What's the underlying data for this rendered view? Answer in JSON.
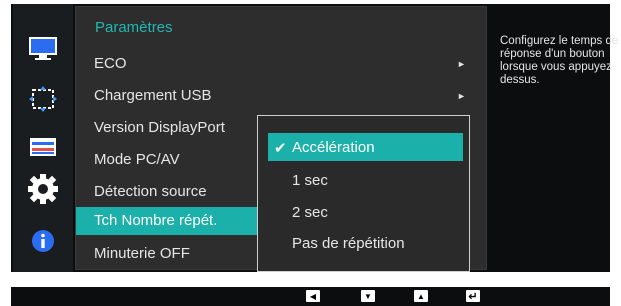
{
  "menu": {
    "title": "Paramètres",
    "items": [
      {
        "label": "ECO",
        "arrow": "►"
      },
      {
        "label": "Chargement USB",
        "arrow": "►"
      },
      {
        "label": "Version DisplayPort",
        "arrow": ""
      },
      {
        "label": "Mode PC/AV",
        "arrow": ""
      },
      {
        "label": "Détection source",
        "arrow": ""
      },
      {
        "label": "Tch Nombre répét.",
        "arrow": ""
      },
      {
        "label": "Minuterie OFF",
        "arrow": ""
      }
    ],
    "selected_index": 5
  },
  "submenu": {
    "check": "✔",
    "options": [
      {
        "label": "Accélération"
      },
      {
        "label": "1 sec"
      },
      {
        "label": "2 sec"
      },
      {
        "label": "Pas de répétition"
      }
    ],
    "selected_index": 0
  },
  "help_text": "Configurez le temps de réponse d'un bouton lorsque vous appuyez dessus.",
  "sidebar_icons": [
    {
      "name": "picture-icon"
    },
    {
      "name": "onscreen-display-icon"
    },
    {
      "name": "size-position-icon"
    },
    {
      "name": "system-gear-icon"
    },
    {
      "name": "information-icon"
    }
  ],
  "key_guide": [
    {
      "name": "left-key-icon",
      "glyph": "◀"
    },
    {
      "name": "down-key-icon",
      "glyph": "▼"
    },
    {
      "name": "up-key-icon",
      "glyph": "▲"
    },
    {
      "name": "enter-key-icon",
      "glyph": "↵"
    }
  ],
  "colors": {
    "accent": "#1bb1aa",
    "title": "#20b8b2",
    "background": "#0b0d0e",
    "panel": "#2d2d2d"
  }
}
